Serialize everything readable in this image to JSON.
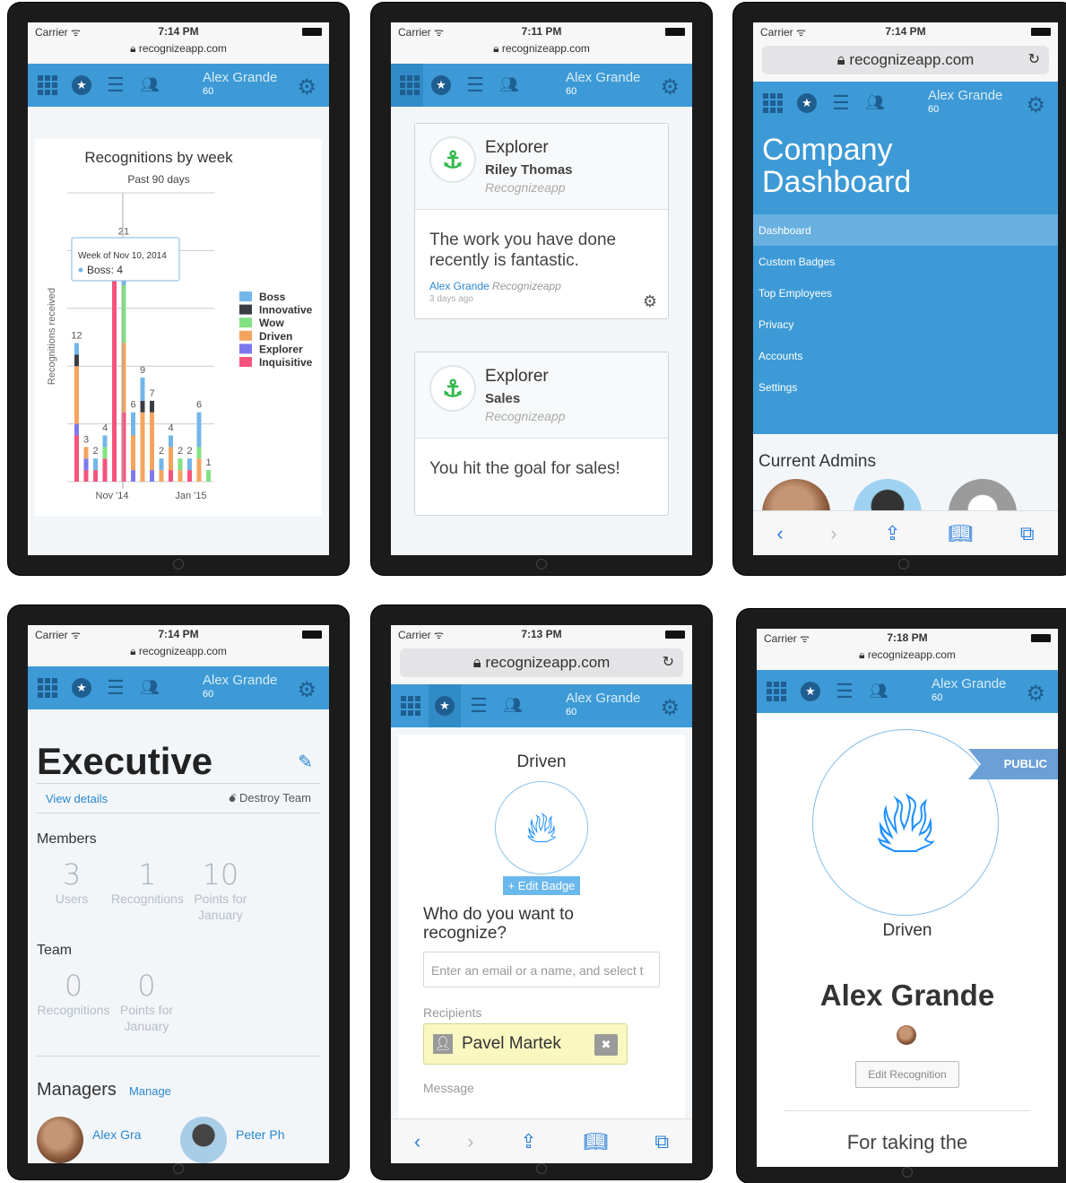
{
  "status": {
    "carrier": "Carrier",
    "wifi": "ᯤ"
  },
  "nav": {
    "user_name": "Alex Grande",
    "points": "60"
  },
  "url": {
    "host": "recognizeapp.com"
  },
  "screen1": {
    "time": "7:14 PM",
    "chart_data": {
      "type": "bar",
      "title": "Recognitions by week",
      "subtitle": "Past 90 days",
      "ylabel": "Recognitions received",
      "x_ticks": [
        "Nov '14",
        "Jan '15"
      ],
      "legend_position": "right",
      "tooltip": {
        "title": "Week of Nov 10, 2014",
        "text": "Boss: 4"
      },
      "series": [
        {
          "name": "Boss",
          "color": "#73b6ea"
        },
        {
          "name": "Innovative",
          "color": "#3b3d45"
        },
        {
          "name": "Wow",
          "color": "#82e283"
        },
        {
          "name": "Driven",
          "color": "#f5a45f"
        },
        {
          "name": "Explorer",
          "color": "#7e78ee"
        },
        {
          "name": "Inquisitive",
          "color": "#f5547c"
        }
      ],
      "totals": [
        12,
        3,
        2,
        4,
        21,
        21,
        6,
        9,
        7,
        2,
        4,
        2,
        2,
        6,
        1
      ],
      "total_labels": [
        "12",
        "3",
        "2",
        "4",
        "",
        "21",
        "6",
        "9",
        "7",
        "2",
        "4",
        "2",
        "2",
        "6",
        "1"
      ],
      "bars": [
        [
          1,
          1,
          0,
          5,
          1,
          4
        ],
        [
          0,
          0,
          0,
          1,
          1,
          1
        ],
        [
          1,
          0,
          0,
          0,
          0,
          1
        ],
        [
          1,
          0,
          1,
          0,
          0,
          2
        ],
        [
          0,
          0,
          0,
          0,
          0,
          21
        ],
        [
          4,
          0,
          5,
          6,
          0,
          6
        ],
        [
          2,
          0,
          0,
          3,
          1,
          0
        ],
        [
          2,
          1,
          0,
          6,
          0,
          0
        ],
        [
          0,
          1,
          0,
          5,
          1,
          0
        ],
        [
          1,
          0,
          0,
          1,
          0,
          0
        ],
        [
          1,
          0,
          0,
          2,
          0,
          1
        ],
        [
          0,
          0,
          1,
          1,
          0,
          0
        ],
        [
          1,
          0,
          0,
          0,
          0,
          1
        ],
        [
          3,
          0,
          1,
          2,
          0,
          0
        ],
        [
          0,
          0,
          1,
          0,
          0,
          0
        ]
      ]
    }
  },
  "screen2": {
    "time": "7:11 PM",
    "cards": [
      {
        "badge": "Explorer",
        "recipient": "Riley Thomas",
        "company": "Recognizeapp",
        "message": "The work you have done recently is fantastic.",
        "sender": "Alex Grande",
        "sender_company": "Recognizeapp",
        "ago": "3 days ago"
      },
      {
        "badge": "Explorer",
        "recipient": "Sales",
        "company": "Recognizeapp",
        "message": "You hit the goal for sales!"
      }
    ]
  },
  "screen3": {
    "time": "7:14 PM",
    "title": "Company Dashboard",
    "menu": [
      "Dashboard",
      "Custom Badges",
      "Top Employees",
      "Privacy",
      "Accounts",
      "Settings"
    ],
    "admins_heading": "Current Admins"
  },
  "screen4": {
    "time": "7:14 PM",
    "team_name": "Executive",
    "view_details": "View details",
    "destroy": "Destroy Team",
    "members_heading": "Members",
    "members_stats": [
      {
        "value": "3",
        "label": "Users"
      },
      {
        "value": "1",
        "label": "Recognitions"
      },
      {
        "value": "10",
        "label": "Points for January"
      }
    ],
    "team_heading": "Team",
    "team_stats": [
      {
        "value": "0",
        "label": "Recognitions"
      },
      {
        "value": "0",
        "label": "Points for January"
      }
    ],
    "managers_heading": "Managers",
    "manage": "Manage",
    "managers": [
      "Alex Gra",
      "Peter Ph"
    ]
  },
  "screen5": {
    "time": "7:13 PM",
    "badge": "Driven",
    "edit_badge": "+ Edit Badge",
    "question": "Who do you want to recognize?",
    "placeholder": "Enter an email or a name, and select t",
    "recipients_label": "Recipients",
    "recipient": "Pavel Martek",
    "message_label": "Message"
  },
  "screen6": {
    "time": "7:18 PM",
    "ribbon": "PUBLIC",
    "badge": "Driven",
    "name": "Alex Grande",
    "edit": "Edit Recognition",
    "reason": "For taking the"
  }
}
